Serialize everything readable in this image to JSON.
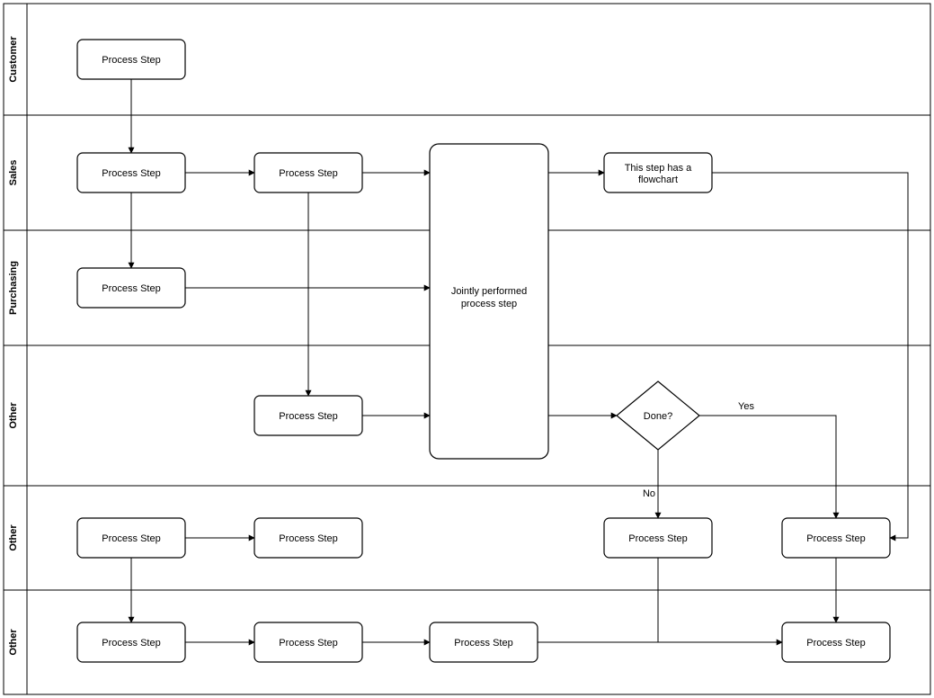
{
  "lanes": [
    {
      "label": "Customer"
    },
    {
      "label": "Sales"
    },
    {
      "label": "Purchasing"
    },
    {
      "label": "Other"
    },
    {
      "label": "Other"
    },
    {
      "label": "Other"
    }
  ],
  "nodes": {
    "n1": {
      "label": "Process Step"
    },
    "n2": {
      "label": "Process Step"
    },
    "n3": {
      "label": "Process Step"
    },
    "n4": {
      "label1": "Jointly performed",
      "label2": "process step"
    },
    "n5": {
      "label1": "This step has a",
      "label2": "flowchart"
    },
    "n6": {
      "label": "Process Step"
    },
    "n7": {
      "label": "Process Step"
    },
    "n8": {
      "label": "Done?"
    },
    "n9": {
      "label": "Process Step"
    },
    "n10": {
      "label": "Process Step"
    },
    "n11": {
      "label": "Process Step"
    },
    "n12": {
      "label": "Process Step"
    },
    "n13": {
      "label": "Process Step"
    },
    "n14": {
      "label": "Process Step"
    },
    "n15": {
      "label": "Process Step"
    },
    "n16": {
      "label": "Process Step"
    }
  },
  "edges": {
    "yes": "Yes",
    "no": "No"
  }
}
